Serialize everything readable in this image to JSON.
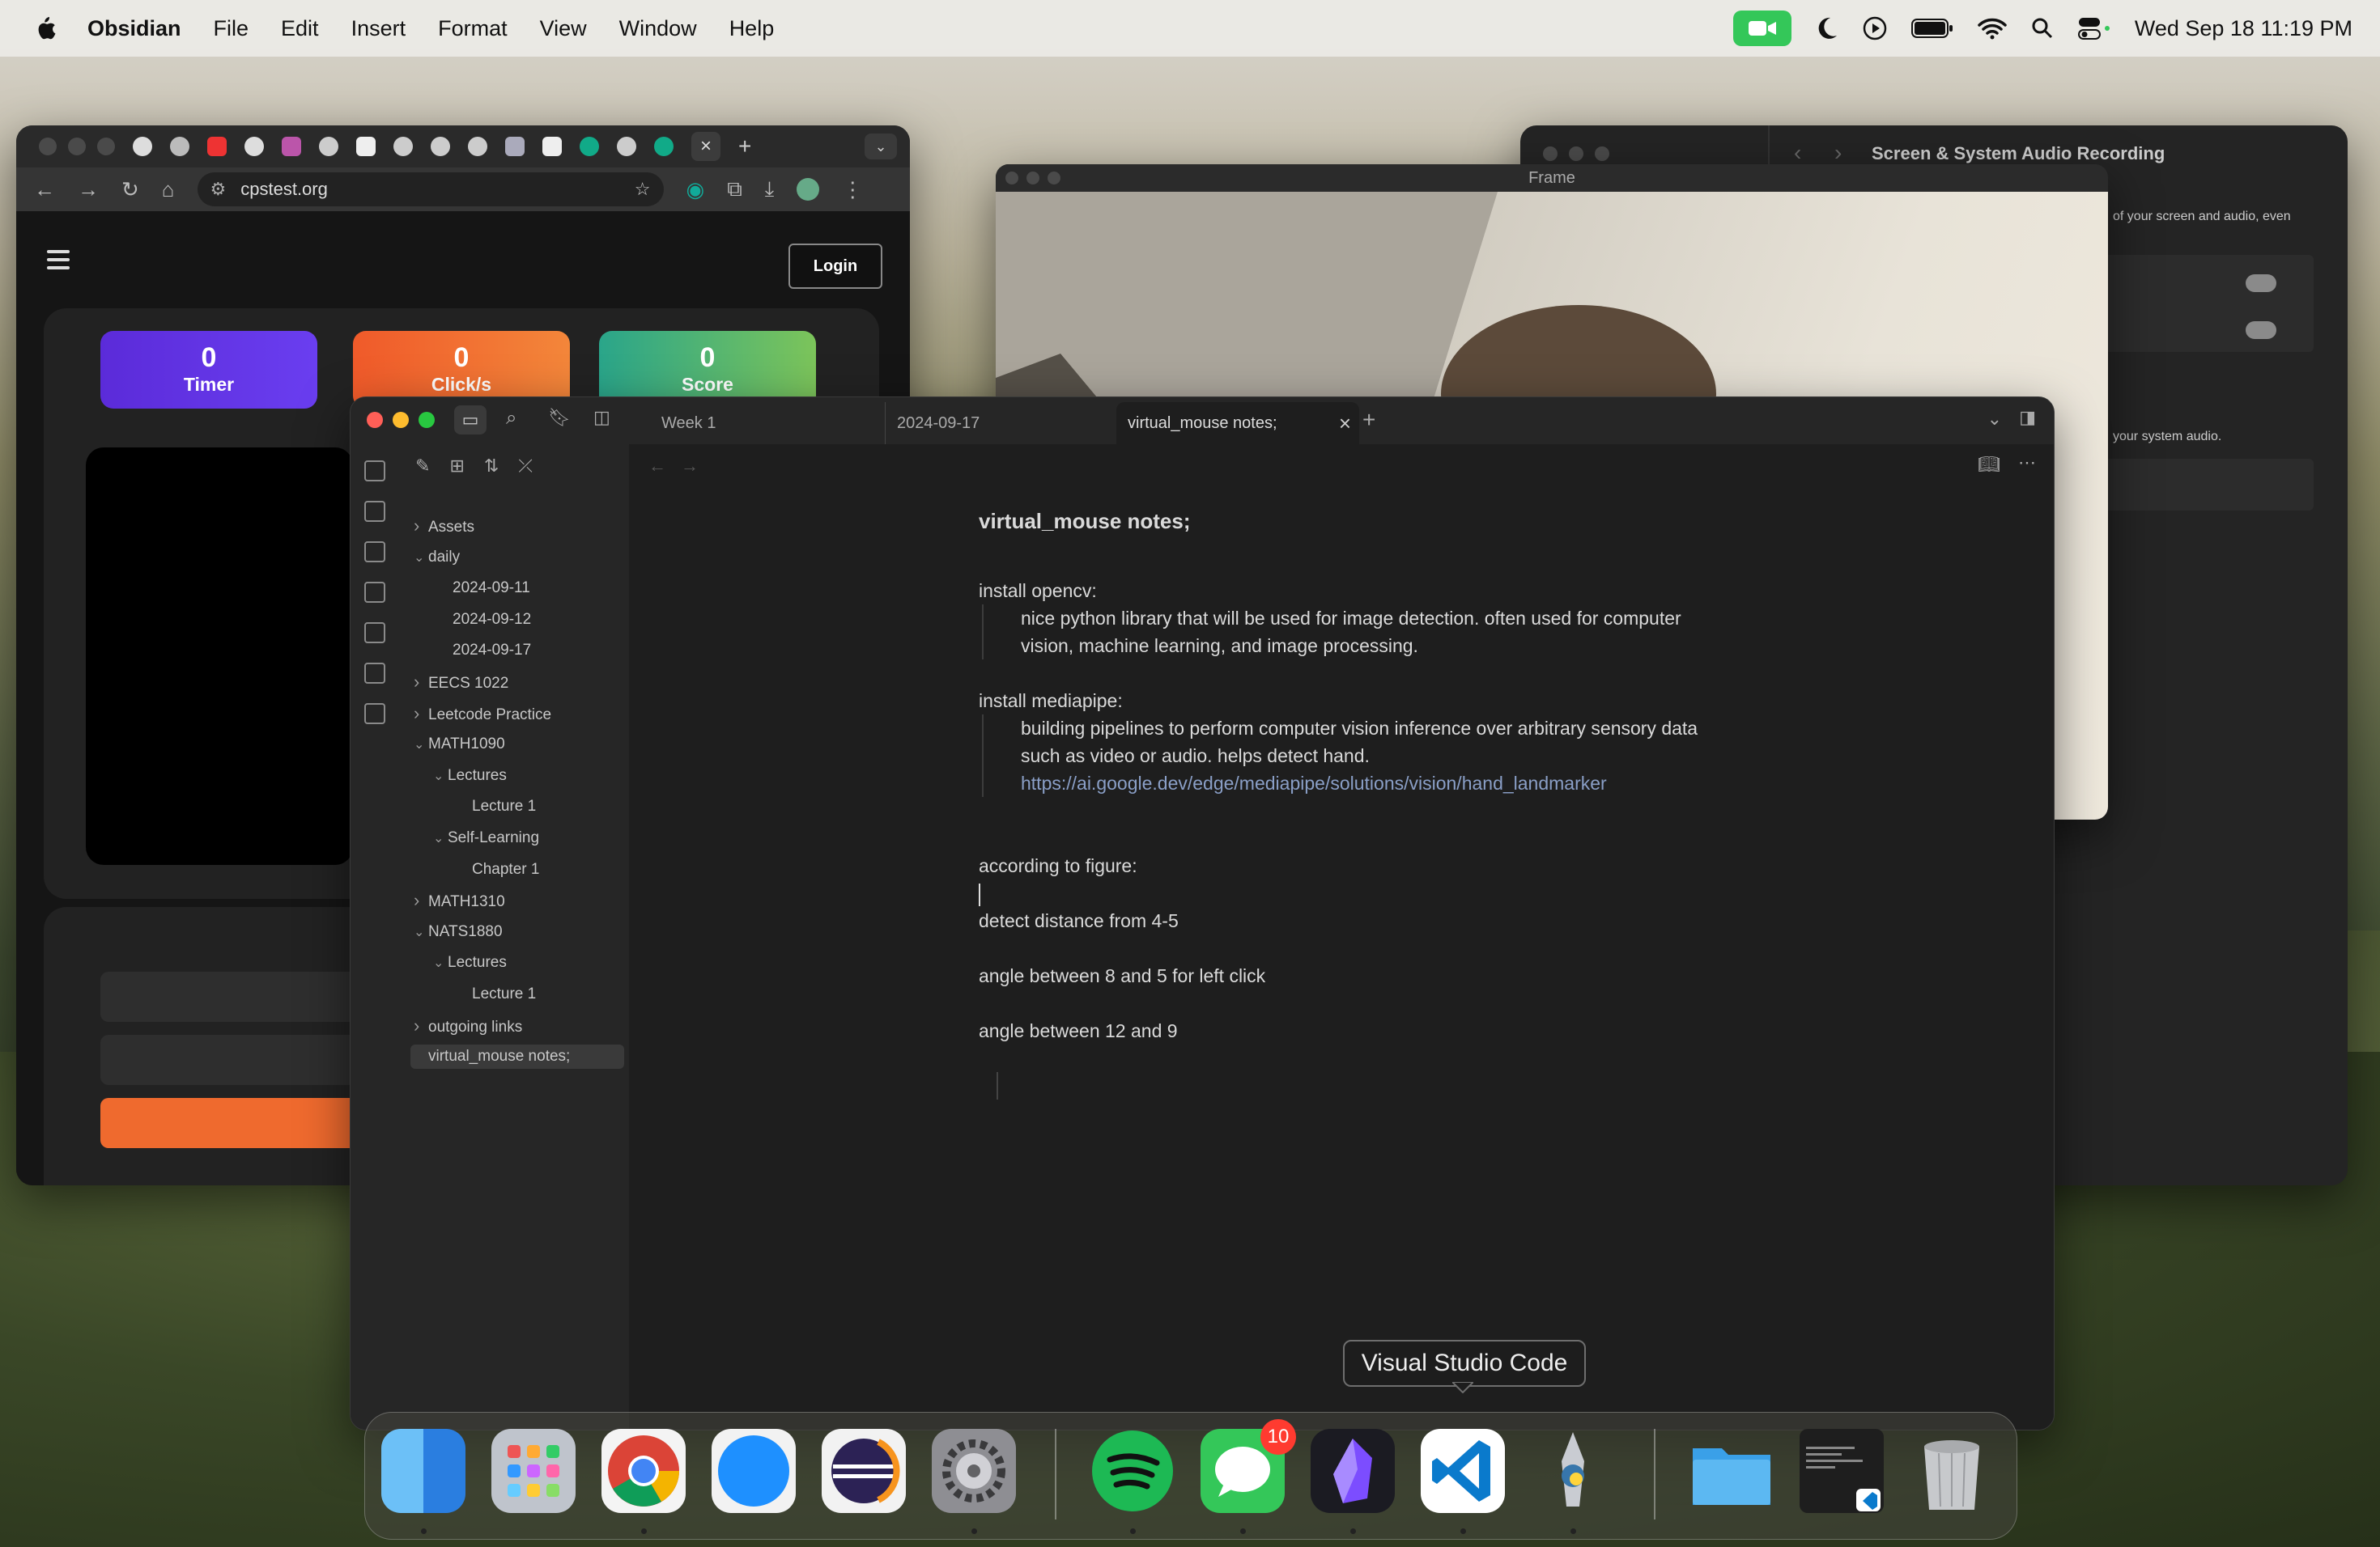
{
  "menubar": {
    "app_name": "Obsidian",
    "items": [
      "File",
      "Edit",
      "Insert",
      "Format",
      "View",
      "Window",
      "Help"
    ],
    "clock": "Wed Sep 18  11:19 PM"
  },
  "chrome": {
    "url": "cpstest.org",
    "login_label": "Login",
    "stats": [
      {
        "value": "0",
        "label": "Timer"
      },
      {
        "value": "0",
        "label": "Click/s"
      },
      {
        "value": "0",
        "label": "Score"
      }
    ]
  },
  "settings": {
    "title": "Screen & System Audio Recording",
    "text1": "of your screen and audio, even",
    "text2": "your system audio."
  },
  "frame": {
    "title": "Frame"
  },
  "obsidian": {
    "tabs": [
      "Week 1",
      "2024-09-17",
      "virtual_mouse notes;"
    ],
    "tree": [
      {
        "label": "Assets",
        "depth": 0,
        "chev": "right"
      },
      {
        "label": "daily",
        "depth": 0,
        "chev": "down"
      },
      {
        "label": "2024-09-11",
        "depth": 1,
        "chev": ""
      },
      {
        "label": "2024-09-12",
        "depth": 1,
        "chev": ""
      },
      {
        "label": "2024-09-17",
        "depth": 1,
        "chev": ""
      },
      {
        "label": "EECS 1022",
        "depth": 0,
        "chev": "right"
      },
      {
        "label": "Leetcode Practice",
        "depth": 0,
        "chev": "right"
      },
      {
        "label": "MATH1090",
        "depth": 0,
        "chev": "down"
      },
      {
        "label": "Lectures",
        "depth": 1,
        "chev": "down"
      },
      {
        "label": "Lecture 1",
        "depth": 2,
        "chev": ""
      },
      {
        "label": "Self-Learning",
        "depth": 1,
        "chev": "down"
      },
      {
        "label": "Chapter 1",
        "depth": 2,
        "chev": ""
      },
      {
        "label": "MATH1310",
        "depth": 0,
        "chev": "right"
      },
      {
        "label": "NATS1880",
        "depth": 0,
        "chev": "down"
      },
      {
        "label": "Lectures",
        "depth": 1,
        "chev": "down"
      },
      {
        "label": "Lecture 1",
        "depth": 2,
        "chev": ""
      },
      {
        "label": "outgoing links",
        "depth": 0,
        "chev": "right"
      },
      {
        "label": "virtual_mouse notes;",
        "depth": 0,
        "chev": "",
        "selected": true
      }
    ],
    "note": {
      "title": "virtual_mouse notes;",
      "h1": "install opencv:",
      "p1a": "nice python library that will be used for image detection. often used for computer",
      "p1b": "vision, machine learning, and image processing.",
      "h2": "install mediapipe:",
      "p2a": "building pipelines to perform computer vision inference over arbitrary sensory data",
      "p2b": "such as video or audio. helps detect hand.",
      "link": "https://ai.google.dev/edge/mediapipe/solutions/vision/hand_landmarker",
      "l1": "according to figure:",
      "l2": "detect distance from 4-5",
      "l3": "angle between 8 and 5 for left click",
      "l4": "angle between 12 and 9"
    }
  },
  "dock": {
    "tooltip": "Visual Studio Code",
    "messages_badge": "10",
    "apps": [
      "finder-icon",
      "launchpad-icon",
      "chrome-icon",
      "safari-icon",
      "eclipse-icon",
      "system-settings-icon",
      "spotify-icon",
      "messages-icon",
      "obsidian-icon",
      "vscode-icon",
      "python-launcher-icon",
      "folder-icon",
      "terminal-window-icon",
      "trash-icon"
    ]
  }
}
